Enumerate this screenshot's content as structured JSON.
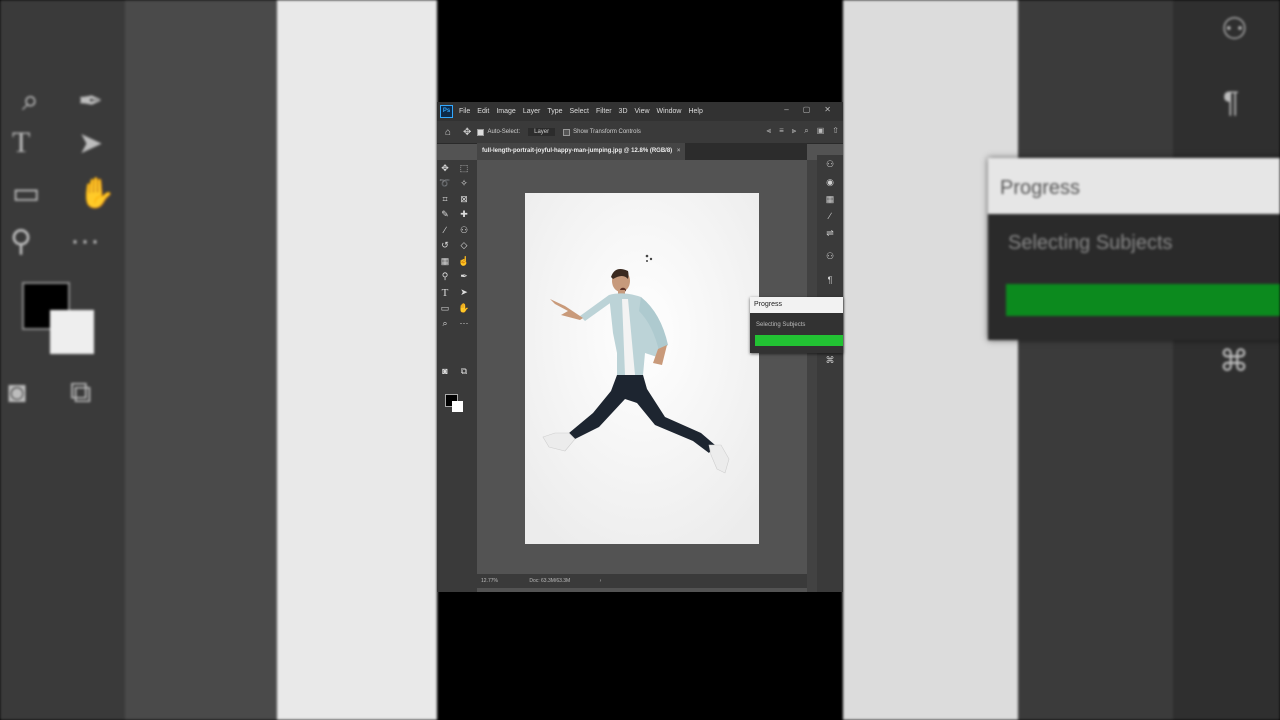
{
  "app": {
    "logo": "Ps",
    "menus": [
      "File",
      "Edit",
      "Image",
      "Layer",
      "Type",
      "Select",
      "Filter",
      "3D",
      "View",
      "Window",
      "Help"
    ],
    "window_controls": [
      "–",
      "▢",
      "✕"
    ]
  },
  "options_bar": {
    "auto_select_label": "Auto-Select:",
    "auto_select_checked": true,
    "layer_dropdown": "Layer",
    "show_transform_label": "Show Transform Controls",
    "show_transform_checked": false
  },
  "document": {
    "tab_title": "full-length-portrait-joyful-happy-man-jumping.jpg @ 12.8% (RGB/8)",
    "tab_close": "×"
  },
  "status_bar": {
    "zoom": "12.77%",
    "doc_info": "Doc: 63.3M/63.3M",
    "arrow": "›"
  },
  "progress_dialog": {
    "title": "Progress",
    "status": "Selecting Subjects",
    "progress": 1.0,
    "color": "#22c233"
  },
  "background": {
    "progress_title": "Progress",
    "progress_status": "Selecting Subjects"
  },
  "colors": {
    "ui_dark": "#323232",
    "panel": "#3a3a3a",
    "workspace": "#535353",
    "accent_ps": "#31a8ff",
    "progress_green": "#22c233"
  },
  "icons": [
    "home-icon",
    "move-icon",
    "marquee-icon",
    "lasso-icon",
    "magic-wand-icon",
    "crop-icon",
    "frame-icon",
    "eyedropper-icon",
    "healing-icon",
    "brush-icon",
    "stamp-icon",
    "history-brush-icon",
    "eraser-icon",
    "gradient-icon",
    "smudge-icon",
    "dodge-icon",
    "pen-icon",
    "type-icon",
    "path-select-icon",
    "rectangle-icon",
    "hand-icon",
    "zoom-icon",
    "more-icon",
    "search-icon",
    "share-icon"
  ]
}
